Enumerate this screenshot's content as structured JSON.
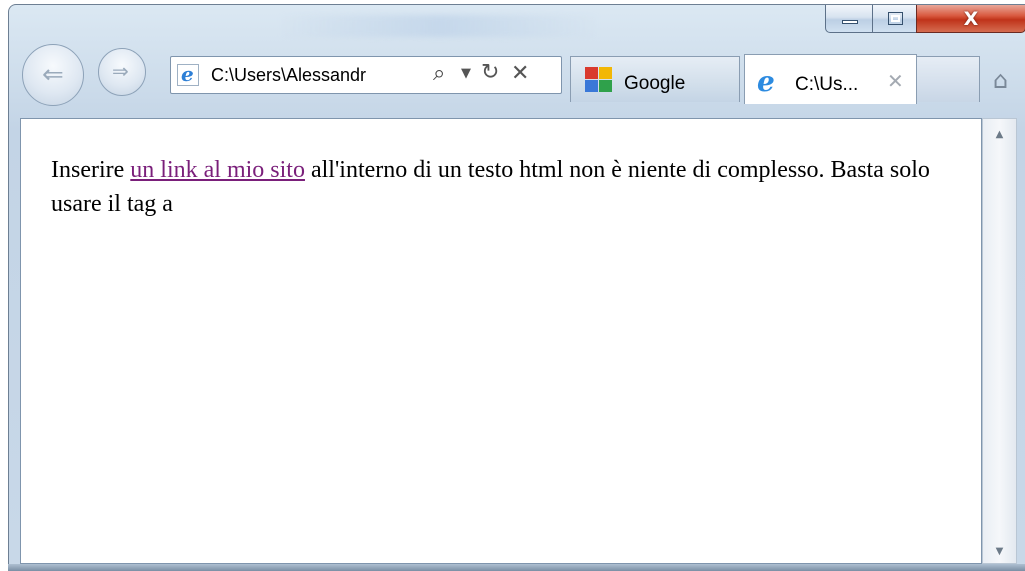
{
  "window": {
    "close_glyph": "X",
    "minimize_glyph": "",
    "maximize_glyph": ""
  },
  "nav": {
    "back_glyph": "⇐",
    "forward_glyph": "⇒"
  },
  "address_bar": {
    "value": "C:\\Users\\Alessandr",
    "search_glyph": "⌕",
    "dropdown_glyph": "▼",
    "refresh_glyph": "↻",
    "stop_glyph": "✕"
  },
  "tabs": [
    {
      "label": "Google",
      "icon": "google-favicon",
      "active": false
    },
    {
      "label": "C:\\Us...",
      "icon": "ie-favicon",
      "active": true,
      "close_glyph": "✕"
    }
  ],
  "home_glyph": "⌂",
  "page": {
    "text_before": "Inserire ",
    "link_text": "un link al mio sito",
    "text_after": " all'interno di un testo html non è niente di complesso. Basta solo usare il tag a"
  },
  "colors": {
    "visited_link": "#7a1f7a",
    "close_button": "#c0331a",
    "ie_blue": "#2d8be0"
  }
}
